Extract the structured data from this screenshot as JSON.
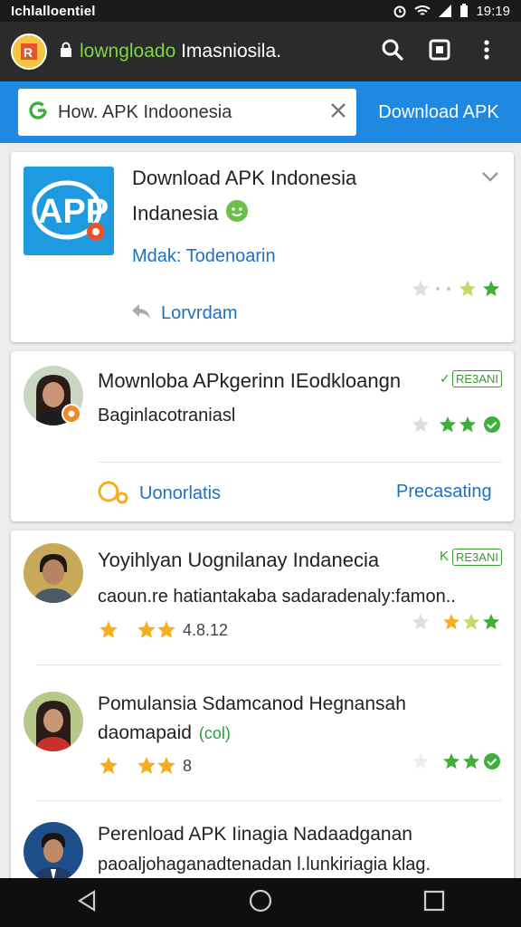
{
  "status_bar": {
    "carrier": "Ichlalloentiel",
    "time": "19:19"
  },
  "browser": {
    "url_green": "lowngloado",
    "url_rest": " Imasniosila."
  },
  "search": {
    "query": "How. APK Indoonesia",
    "download_link": "Download APK"
  },
  "card1": {
    "title_line1": "Download APK Indonesia",
    "title_line2": "Indanesia",
    "meta": "Mdak: Todenoarin",
    "action": "Lorvrdam"
  },
  "card2": {
    "title": "Mownloba APkgerinn IEodkloangn",
    "tag": "RE3ANI",
    "subtitle": "Baginlacotraniasl",
    "action_left": "Uonorlatis",
    "action_right": "Precasating"
  },
  "results": [
    {
      "title": "Yoyihlyan Uognilanay Indanecia",
      "tag": "RE3ANI",
      "subtitle": "caoun.re hatiantakaba sadaradenaly:famon..",
      "rating": "4.8.12"
    },
    {
      "title": "Pomulansia Sdamcanod Hegnansah",
      "title2": "daomapaid",
      "title2_extra": "(col)",
      "rating": "8"
    },
    {
      "title": "Perenload APK Iinagia Nadaadganan",
      "subtitle": "paoaljohaganadtenadan l.lunkiriagia klag."
    }
  ],
  "colors": {
    "accent": "#1f88e0",
    "link": "#1f6fc2",
    "star_gold": "#f2b01e",
    "star_green": "#3fae3a"
  }
}
